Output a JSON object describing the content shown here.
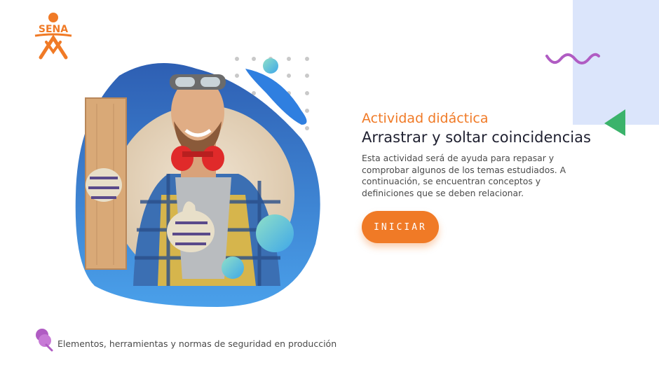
{
  "logo": {
    "text": "SENA",
    "color": "#f07a26"
  },
  "activity": {
    "eyebrow": "Actividad didáctica",
    "title": "Arrastrar y soltar coincidencias",
    "description": "Esta actividad será de ayuda para repasar y comprobar algunos de los temas estudiados. A continuación, se encuentran conceptos y definiciones que se deben relacionar."
  },
  "actions": {
    "start_label": "INICIAR"
  },
  "footer": {
    "course_title": "Elementos, herramientas y normas de seguridad en producción"
  },
  "colors": {
    "accent": "#f07a26",
    "purple": "#b05cc3",
    "green": "#3bb36b",
    "blue": "#2f6ec2",
    "light_bg": "#dbe5fb"
  },
  "icons": {
    "footer_icon": "pin-icon",
    "hero": "worker-illustration"
  }
}
